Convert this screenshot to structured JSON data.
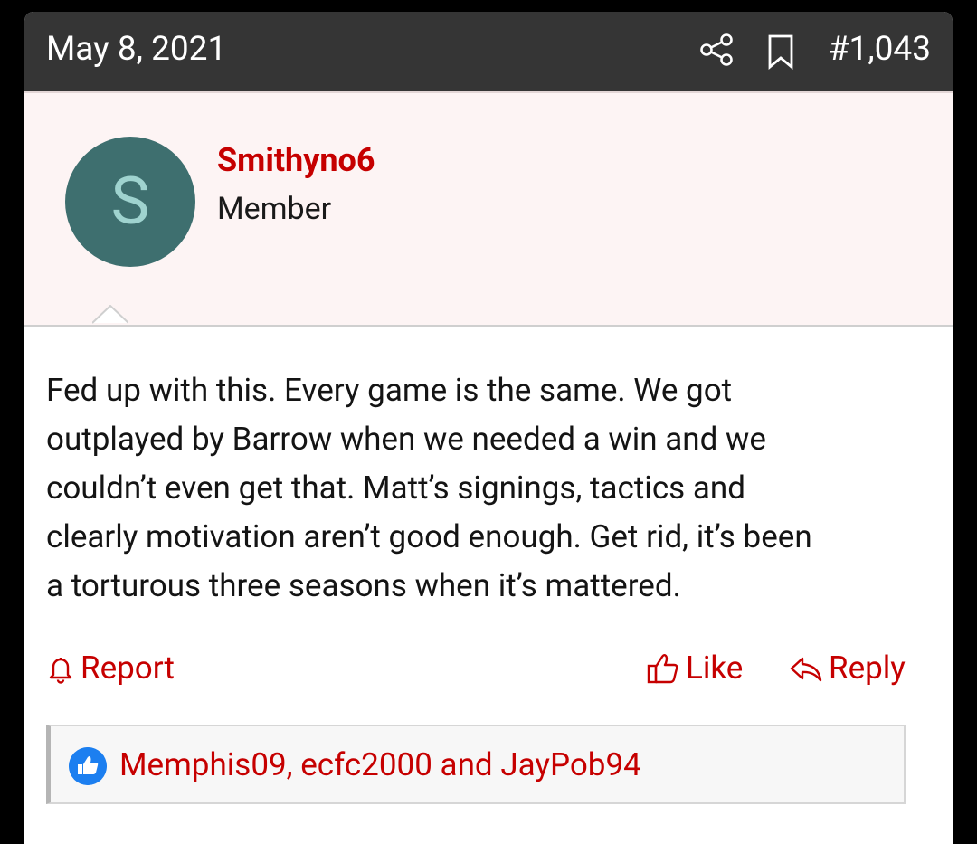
{
  "post": {
    "date": "May 8, 2021",
    "number": "#1,043",
    "icons": {
      "share": "share-icon",
      "bookmark": "bookmark-icon"
    }
  },
  "user": {
    "avatar_letter": "S",
    "name": "Smithyno6",
    "title": "Member"
  },
  "body": {
    "lines": [
      "Fed up with this. Every game is the same. We got",
      "outplayed by Barrow when we needed a win and we",
      "couldn’t even get that. Matt’s signings, tactics and",
      "clearly motivation aren’t good enough. Get rid, it’s been",
      "a torturous three seasons when it’s mattered."
    ]
  },
  "actions": {
    "report": "Report",
    "like": "Like",
    "reply": "Reply"
  },
  "reactions": {
    "users_text": "Memphis09, ecfc2000 and JayPob94"
  },
  "colors": {
    "header_bg": "#353535",
    "accent_red": "#c60000",
    "user_block_bg": "#fdf4f4",
    "avatar_bg": "#3e6f6f",
    "like_badge": "#1c7ff0"
  }
}
